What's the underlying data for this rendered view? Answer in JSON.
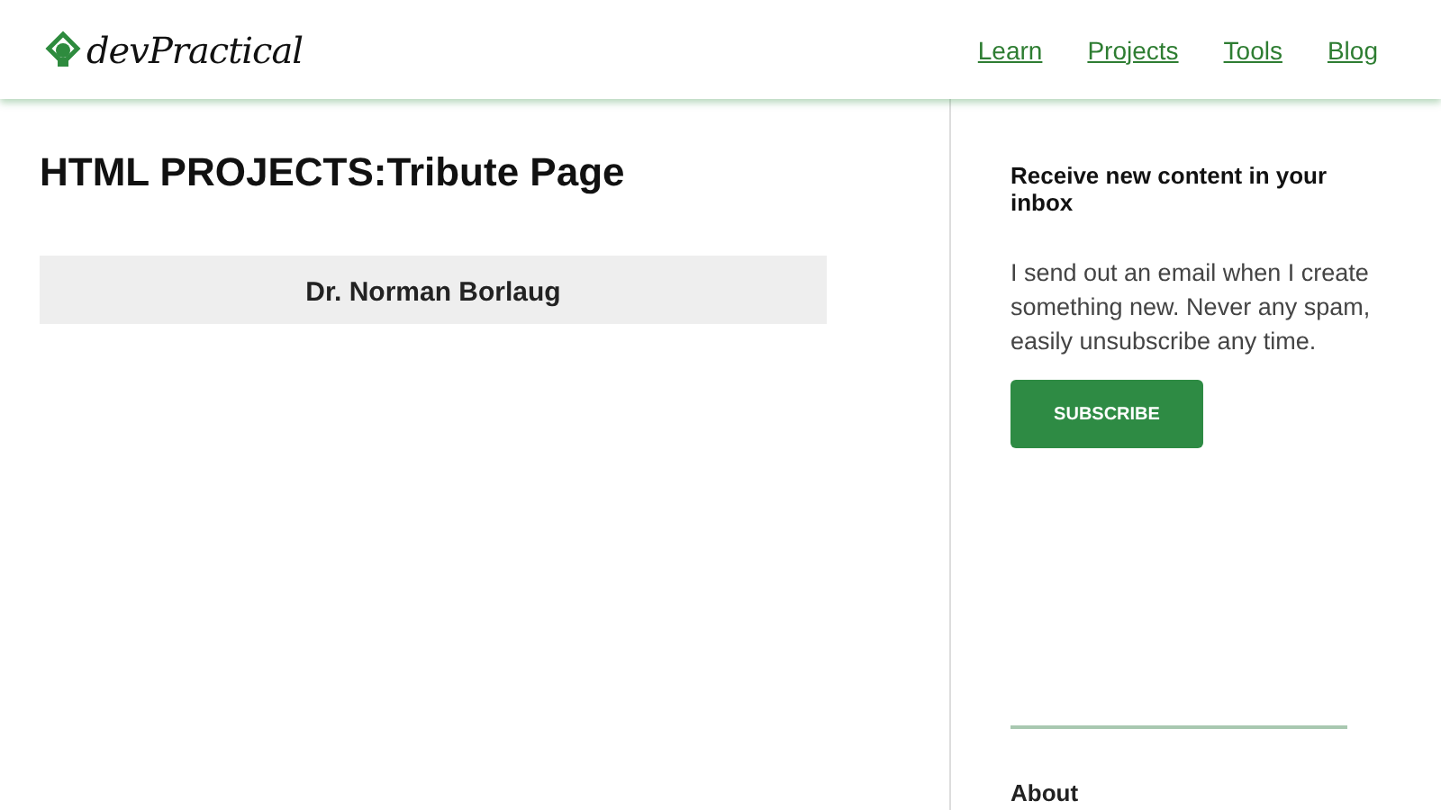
{
  "header": {
    "logo": "devPractical",
    "nav": [
      "Learn",
      "Projects",
      "Tools",
      "Blog"
    ]
  },
  "main": {
    "title": "HTML PROJECTS:Tribute Page",
    "embed_heading": "Dr. Norman Borlaug"
  },
  "sidebar": {
    "newsletter_title": "Receive new content in your inbox",
    "newsletter_text": "I send out an email when I create something new. Never any spam, easily unsubscribe any time.",
    "button": "SUBSCRIBE",
    "about_title": "About"
  }
}
